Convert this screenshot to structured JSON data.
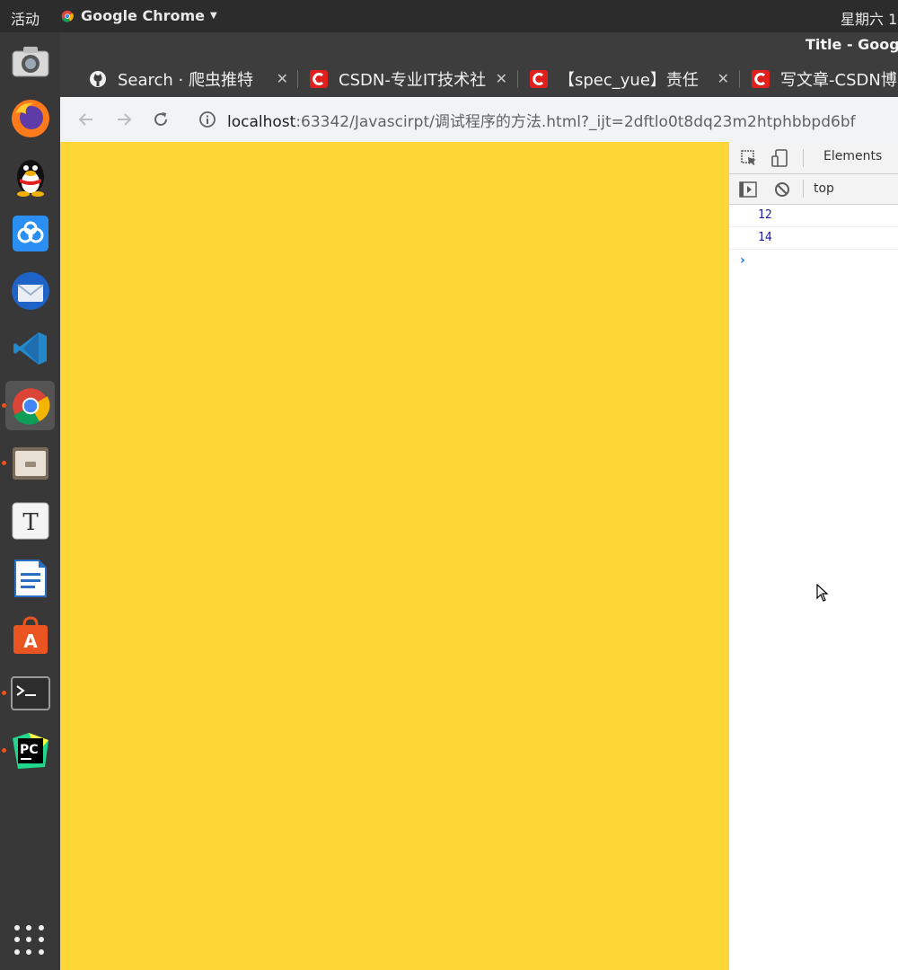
{
  "topbar": {
    "activities": "活动",
    "app_name": "Google Chrome",
    "clock": "星期六 1"
  },
  "dock": {
    "apps": [
      {
        "name": "Screenshot",
        "icon": "camera-icon"
      },
      {
        "name": "Firefox",
        "icon": "firefox-icon"
      },
      {
        "name": "QQ",
        "icon": "qq-penguin-icon"
      },
      {
        "name": "Baidu Netdisk",
        "icon": "cloud-icon"
      },
      {
        "name": "Thunderbird",
        "icon": "thunderbird-icon"
      },
      {
        "name": "VS Code",
        "icon": "vscode-icon"
      },
      {
        "name": "Google Chrome",
        "icon": "chrome-icon",
        "active": true
      },
      {
        "name": "Files",
        "icon": "files-icon"
      },
      {
        "name": "Typora",
        "icon": "typora-icon"
      },
      {
        "name": "LibreOffice Writer",
        "icon": "writer-icon"
      },
      {
        "name": "Ubuntu Software",
        "icon": "software-center-icon"
      },
      {
        "name": "Terminal",
        "icon": "terminal-icon"
      },
      {
        "name": "PyCharm",
        "icon": "pycharm-icon"
      }
    ],
    "show_apps_icon": "apps-grid-icon"
  },
  "window": {
    "title": "Title - Goog"
  },
  "tabs": [
    {
      "label": "Search · 爬虫推特",
      "favicon": "github-icon"
    },
    {
      "label": "CSDN-专业IT技术社",
      "favicon": "csdn-icon"
    },
    {
      "label": "【spec_yue】责任",
      "favicon": "csdn-icon"
    },
    {
      "label": "写文章-CSDN博",
      "favicon": "csdn-icon"
    }
  ],
  "toolbar": {
    "url_host": "localhost",
    "url_rest": ":63342/Javascirpt/调试程序的方法.html?_ijt=2dftlo0t8dq23m2htphbbpd6bf"
  },
  "page": {
    "background_color": "#fed636"
  },
  "devtools": {
    "elements_tab": "Elements",
    "context": "top",
    "console_output": [
      "12",
      "14"
    ],
    "prompt": "›"
  }
}
